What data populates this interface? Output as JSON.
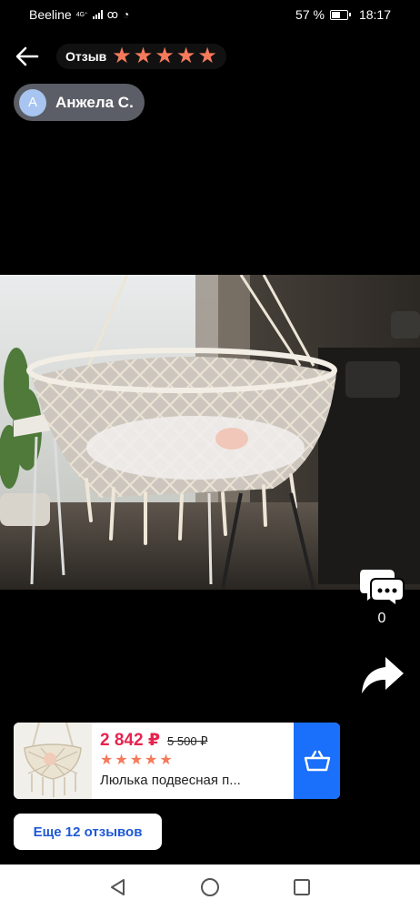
{
  "status_bar": {
    "carrier": "Beeline",
    "network": "4G⁺",
    "battery_percent": "57 %",
    "battery_level": 0.57,
    "time": "18:17",
    "icons": [
      "signal-icon",
      "ok-icon",
      "whatsapp-icon",
      "battery-icon"
    ]
  },
  "header": {
    "review_label": "Отзыв",
    "rating": 5
  },
  "author": {
    "initial": "А",
    "name": "Анжела С."
  },
  "photo": {
    "subject": "hanging macrame baby cradle"
  },
  "actions": {
    "comment_count": "0"
  },
  "product": {
    "price": "2 842 ₽",
    "old_price": "5 500 ₽",
    "rating": 5,
    "title": "Люлька подвесная п..."
  },
  "more_reviews_label": "Еще 12 отзывов",
  "colors": {
    "star": "#f47a5c",
    "price": "#e6244f",
    "cart_button": "#1a6ffb",
    "link": "#1d59d6",
    "author_chip": "#5b5e66"
  }
}
